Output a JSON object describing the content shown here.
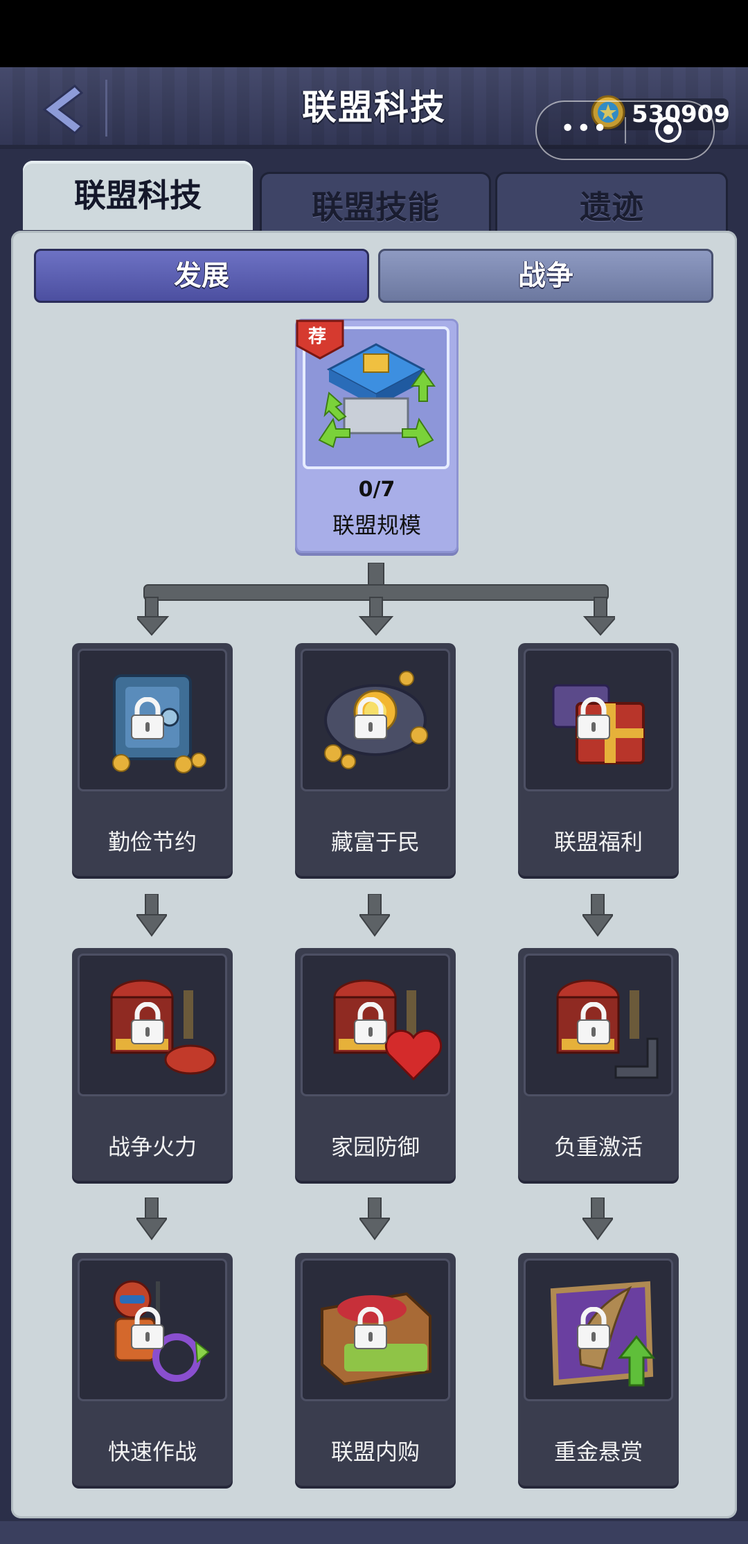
{
  "header": {
    "title": "联盟科技",
    "coins": "530909"
  },
  "tabs": [
    {
      "label": "联盟科技",
      "active": true
    },
    {
      "label": "联盟技能",
      "active": false
    },
    {
      "label": "遗迹",
      "active": false
    }
  ],
  "subtabs": [
    {
      "label": "发展",
      "active": true
    },
    {
      "label": "战争",
      "active": false
    }
  ],
  "root": {
    "badge": "荐",
    "progress": "0/7",
    "name": "联盟规模"
  },
  "tech_rows": [
    [
      {
        "name": "勤俭节约",
        "icon": "safe-icon",
        "locked": true
      },
      {
        "name": "藏富于民",
        "icon": "gold-mine-icon",
        "locked": true
      },
      {
        "name": "联盟福利",
        "icon": "gift-crate-icon",
        "locked": true
      }
    ],
    [
      {
        "name": "战争火力",
        "icon": "cannon-building-icon",
        "locked": true
      },
      {
        "name": "家园防御",
        "icon": "heart-building-icon",
        "locked": true
      },
      {
        "name": "负重激活",
        "icon": "weight-building-icon",
        "locked": true
      }
    ],
    [
      {
        "name": "快速作战",
        "icon": "soldier-icon",
        "locked": true
      },
      {
        "name": "联盟内购",
        "icon": "discount-chest-icon",
        "locked": true
      },
      {
        "name": "重金悬赏",
        "icon": "bounty-scroll-icon",
        "locked": true
      }
    ]
  ],
  "colors": {
    "panel_bg": "#cdd6da",
    "card_dark": "#3a3d4e",
    "root_card": "#a8aee8",
    "subtab_active": "#5a5eb0"
  }
}
